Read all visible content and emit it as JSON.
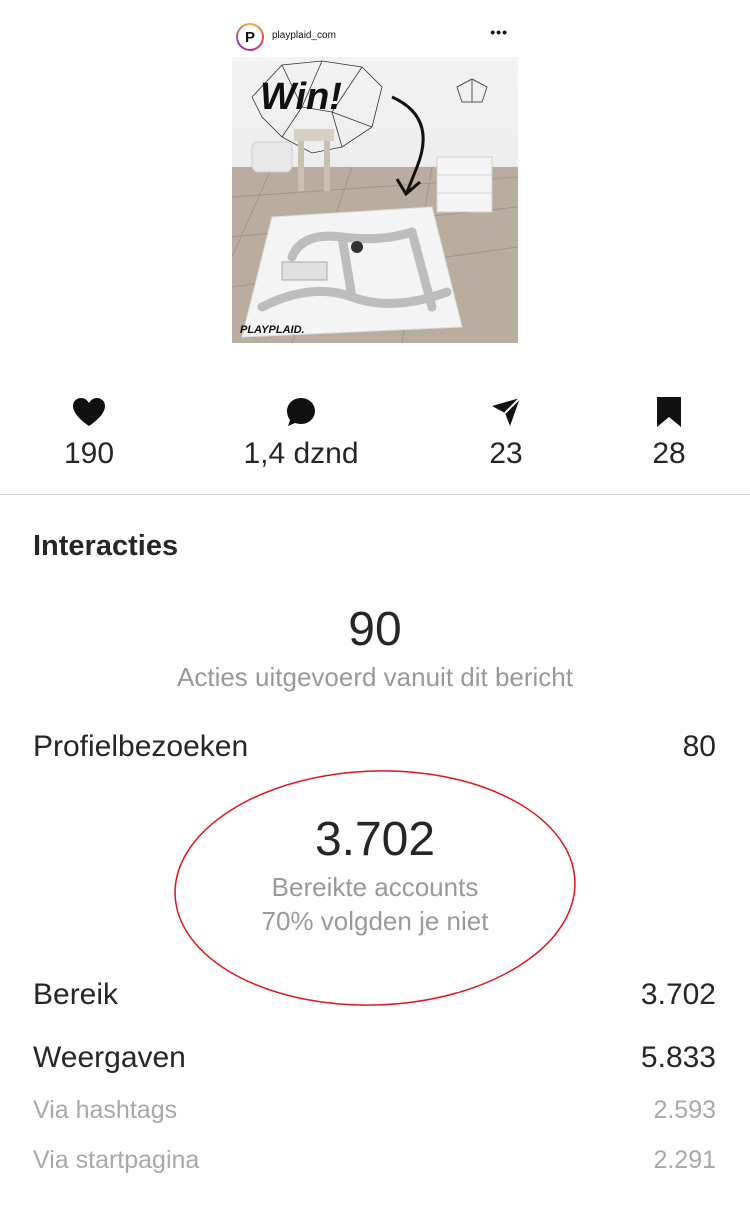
{
  "post": {
    "username": "playplaid_com",
    "avatar_letter": "P",
    "image": {
      "overlay_text": "Win!",
      "brand": "PLAYPLAID."
    }
  },
  "stats": {
    "likes": "190",
    "comments": "1,4 dznd",
    "shares": "23",
    "saves": "28"
  },
  "insights": {
    "section_title": "Interacties",
    "actions_count": "90",
    "actions_label": "Acties uitgevoerd vanuit dit bericht",
    "profile_visits_label": "Profielbezoeken",
    "profile_visits_value": "80",
    "reached_count": "3.702",
    "reached_label": "Bereikte accounts",
    "reached_sub": "70% volgden je niet",
    "reach_label": "Bereik",
    "reach_value": "3.702",
    "impressions_label": "Weergaven",
    "impressions_value": "5.833",
    "via_hashtags_label": "Via hashtags",
    "via_hashtags_value": "2.593",
    "via_home_label": "Via startpagina",
    "via_home_value": "2.291"
  },
  "colors": {
    "annotation_ellipse": "#e0141e",
    "primary_text": "#262626",
    "secondary_text": "#999999"
  },
  "icons": [
    "heart-icon",
    "comment-icon",
    "share-icon",
    "bookmark-icon",
    "more-options-icon"
  ]
}
